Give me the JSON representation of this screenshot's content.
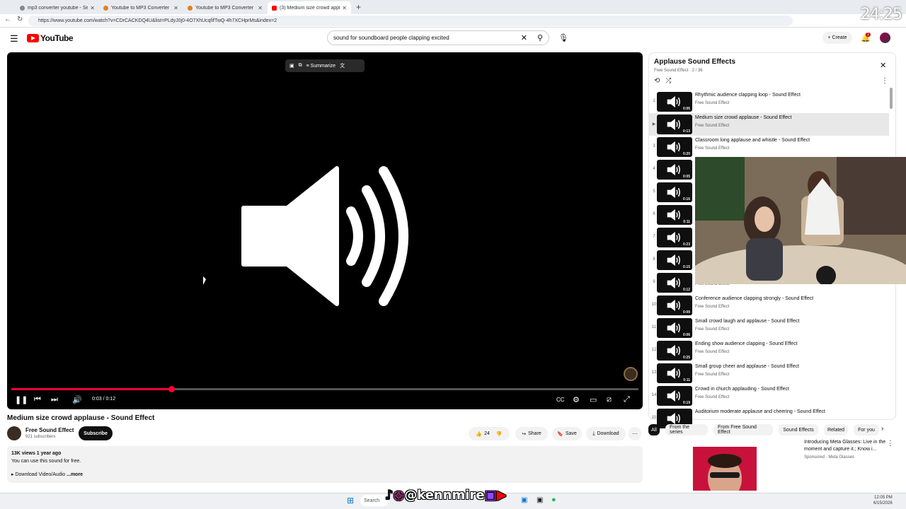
{
  "browser": {
    "tabs": [
      {
        "title": "mp3 converter youtube - Search",
        "active": false
      },
      {
        "title": "Youtube to MP3 Converter",
        "active": false
      },
      {
        "title": "Youtube to MP3 Converter",
        "active": false
      },
      {
        "title": "(3) Medium size crowd applau",
        "active": true
      }
    ],
    "url": "https://www.youtube.com/watch?v=CDrCACKDQ4U&list=PLdyJ0j0-4O7XhUcqfifTwQ-4h7XCHprMs&index=2",
    "overlay_clock": "24:25"
  },
  "header": {
    "logo_text": "YouTube",
    "search_value": "sound for soundboard people clapping excited",
    "create_label": "Create",
    "notification_count": "1"
  },
  "player": {
    "toolbar_summarize": "Summarize",
    "time": "0:03 / 0:12",
    "progress_fraction": 0.25
  },
  "video": {
    "title": "Medium size crowd applause - Sound Effect",
    "channel": "Free Sound Effect",
    "subscribers": "921 subscribers",
    "subscribe_label": "Subscribe",
    "likes": "24",
    "share_label": "Share",
    "save_label": "Save",
    "download_label": "Download",
    "views_time": "13K views  1 year ago",
    "description_line": "You can use this sound for free.",
    "description_link": "▸ Download Video/Audio",
    "more_label": "...more"
  },
  "playlist": {
    "title": "Applause Sound Effects",
    "subtitle": "Free Sound Effect · 2 / 36",
    "items": [
      {
        "num": "1",
        "title": "Rhythmic audience clapping loop - Sound Effect",
        "channel": "Free Sound Effect",
        "duration": "0:06"
      },
      {
        "num": "▶",
        "title": "Medium size crowd applause - Sound Effect",
        "channel": "Free Sound Effect",
        "duration": "0:13"
      },
      {
        "num": "3",
        "title": "Classroom long applause and whistle - Sound Effect",
        "channel": "Free Sound Effect",
        "duration": "0:20"
      },
      {
        "num": "4",
        "title": "",
        "channel": "",
        "duration": "0:05"
      },
      {
        "num": "5",
        "title": "",
        "channel": "",
        "duration": "0:16"
      },
      {
        "num": "6",
        "title": "",
        "channel": "",
        "duration": "0:11"
      },
      {
        "num": "7",
        "title": "",
        "channel": "",
        "duration": "0:23"
      },
      {
        "num": "8",
        "title": "",
        "channel": "",
        "duration": "0:15"
      },
      {
        "num": "9",
        "title": "",
        "channel": "Free Sound Effect",
        "duration": "0:12"
      },
      {
        "num": "10",
        "title": "Conference audience clapping strongly - Sound Effect",
        "channel": "Free Sound Effect",
        "duration": "0:09"
      },
      {
        "num": "11",
        "title": "Small crowd laugh and applause - Sound Effect",
        "channel": "Free Sound Effect",
        "duration": "0:06"
      },
      {
        "num": "12",
        "title": "Ending show audience clapping - Sound Effect",
        "channel": "Free Sound Effect",
        "duration": "0:25"
      },
      {
        "num": "13",
        "title": "Small group cheer and applause - Sound Effect",
        "channel": "Free Sound Effect",
        "duration": "0:11"
      },
      {
        "num": "14",
        "title": "Crowd in church applauding - Sound Effect",
        "channel": "Free Sound Effect",
        "duration": "0:19"
      },
      {
        "num": "15",
        "title": "Auditorium moderate applause and cheering - Sound Effect",
        "channel": "",
        "duration": ""
      }
    ]
  },
  "chips": [
    "All",
    "From the series",
    "From Free Sound Effect",
    "Sound Effects",
    "Related",
    "For you"
  ],
  "ad": {
    "title": "Introducing Meta Glasses: Live in the moment and capture it.; Know i...",
    "sponsor": "Sponsored · Meta Glasses"
  },
  "taskbar": {
    "search_label": "Search",
    "social_handle": "@kennmire",
    "time": "12:05 PM",
    "date": "6/15/2026"
  },
  "colors": {
    "accent": "#ff0033",
    "brand": "#ff0000"
  }
}
